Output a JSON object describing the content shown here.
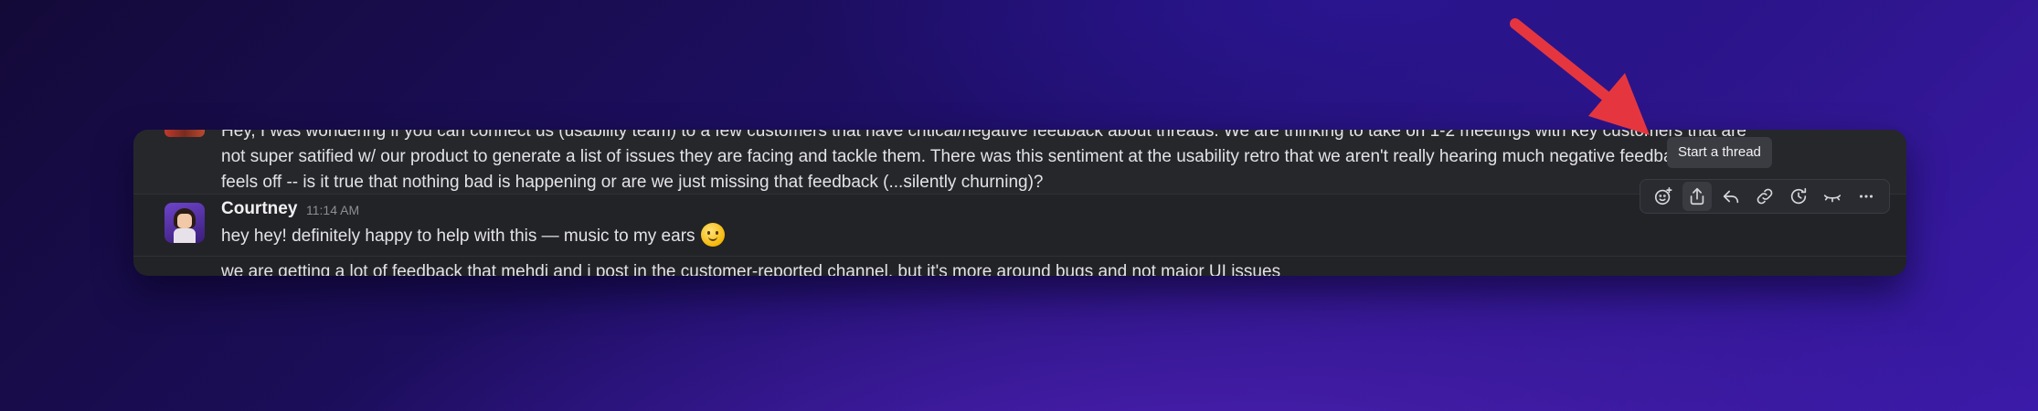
{
  "messages": {
    "first": {
      "line1": "Hey, I was wondering if you can connect us (usability team) to a few customers that have critical/negative feedback about threads. We are thinking to take on 1-2 meetings with key customers that are",
      "line2": "not super satified w/ our product to generate a list of issues they are facing and tackle them. There was this sentiment at the usability retro that we aren't really hearing much negative feedback and that",
      "line3": "feels off -- is it true that nothing bad is happening or are we just missing that feedback (...silently churning)?"
    },
    "second": {
      "author": "Courtney",
      "time": "11:14 AM",
      "text": "hey hey! definitely happy to help with this — music to my ears"
    },
    "third": {
      "text": "we are getting a lot of feedback that mehdi and i post in the customer-reported channel, but it's more around bugs and not major UI issues"
    }
  },
  "tooltip": {
    "text": "Start a thread"
  },
  "toolbar": {
    "icons": [
      "add-reaction-icon",
      "share-icon",
      "reply-icon",
      "link-icon",
      "remind-icon",
      "mark-unread-icon",
      "more-icon"
    ]
  },
  "colors": {
    "arrow": "#e5363f",
    "panel": "#222327",
    "emoji": "#f4b400"
  }
}
